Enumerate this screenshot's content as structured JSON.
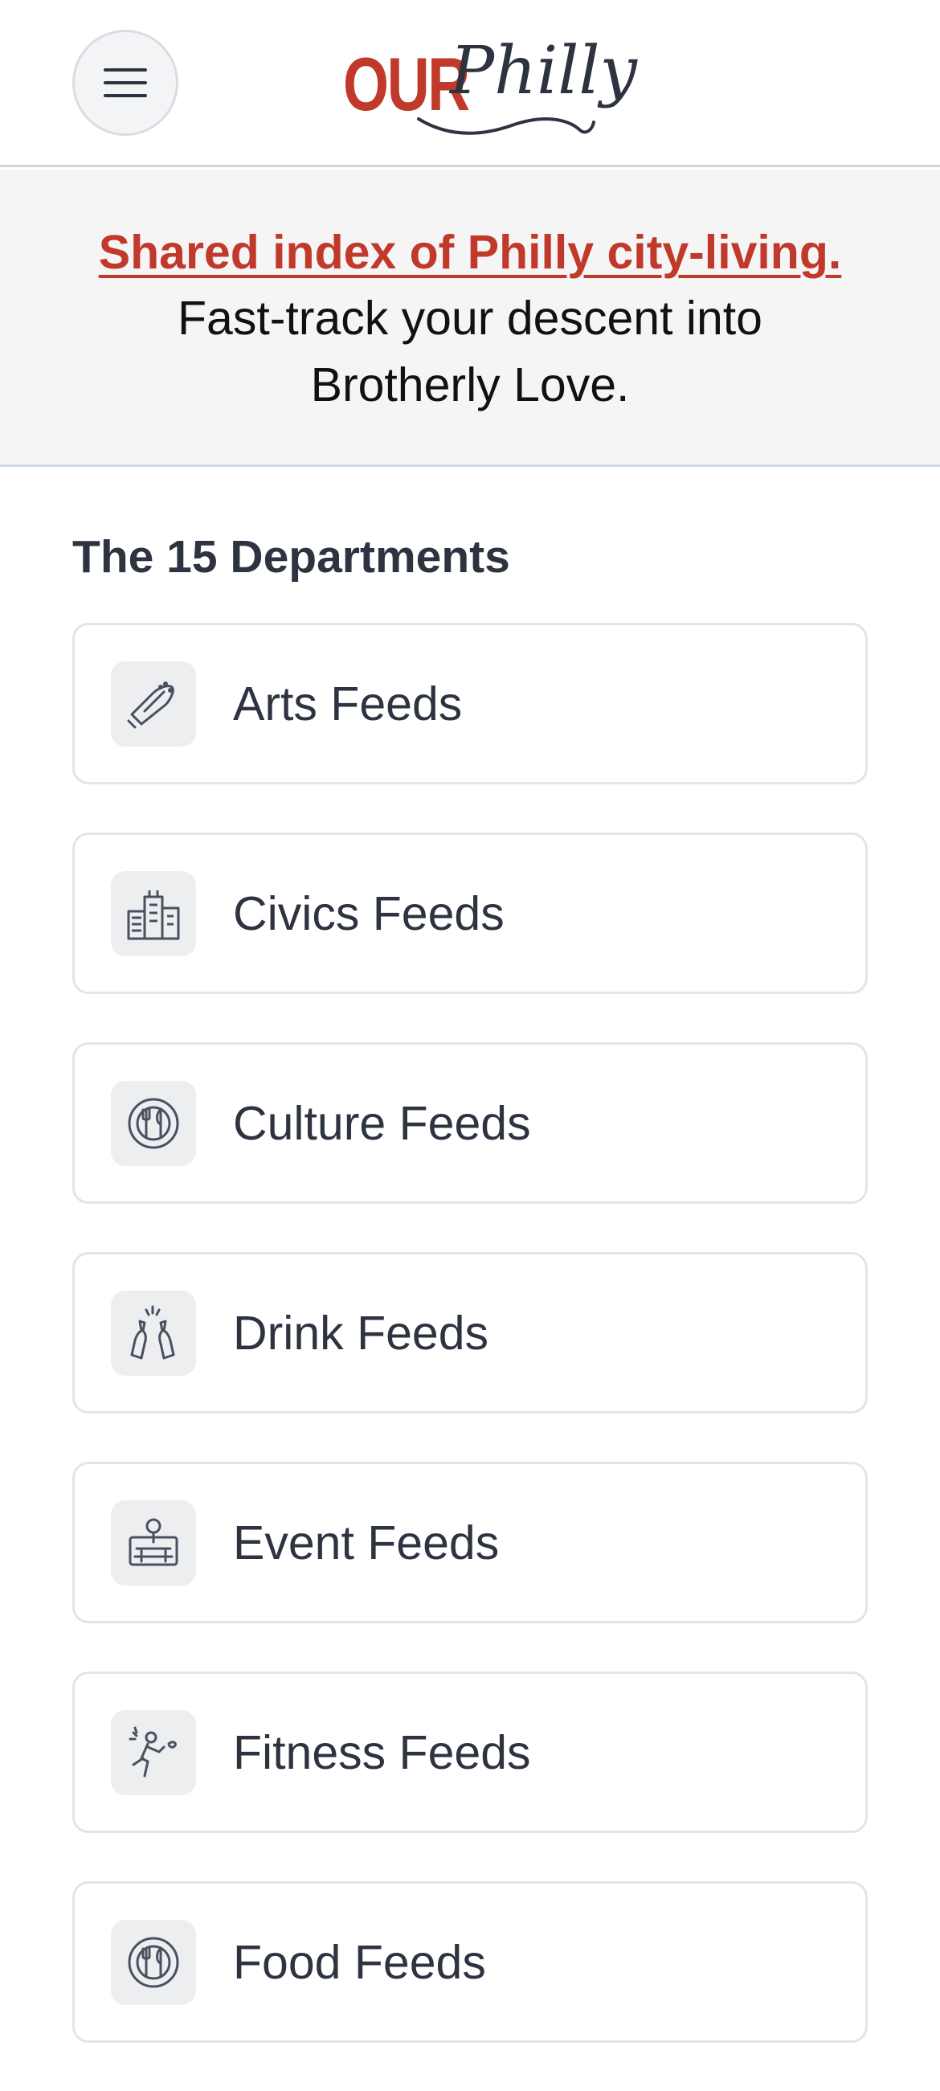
{
  "header": {
    "menu_icon": "hamburger-icon",
    "logo": {
      "word1": "OUR",
      "word2": "Philly"
    },
    "colors": {
      "brand_red": "#c0392b",
      "ink": "#2d3340"
    }
  },
  "banner": {
    "link_text": "Shared index of Philly city-living.",
    "text": "Fast-track your descent into Brotherly Love."
  },
  "section": {
    "title": "The 15 Departments"
  },
  "departments": [
    {
      "label": "Arts Feeds",
      "icon": "guitar-icon"
    },
    {
      "label": "Civics Feeds",
      "icon": "city-buildings-icon"
    },
    {
      "label": "Culture Feeds",
      "icon": "plate-utensils-icon"
    },
    {
      "label": "Drink Feeds",
      "icon": "beer-bottles-icon"
    },
    {
      "label": "Event Feeds",
      "icon": "event-venue-icon"
    },
    {
      "label": "Fitness Feeds",
      "icon": "runner-icon"
    },
    {
      "label": "Food Feeds",
      "icon": "plate-utensils-icon"
    }
  ]
}
